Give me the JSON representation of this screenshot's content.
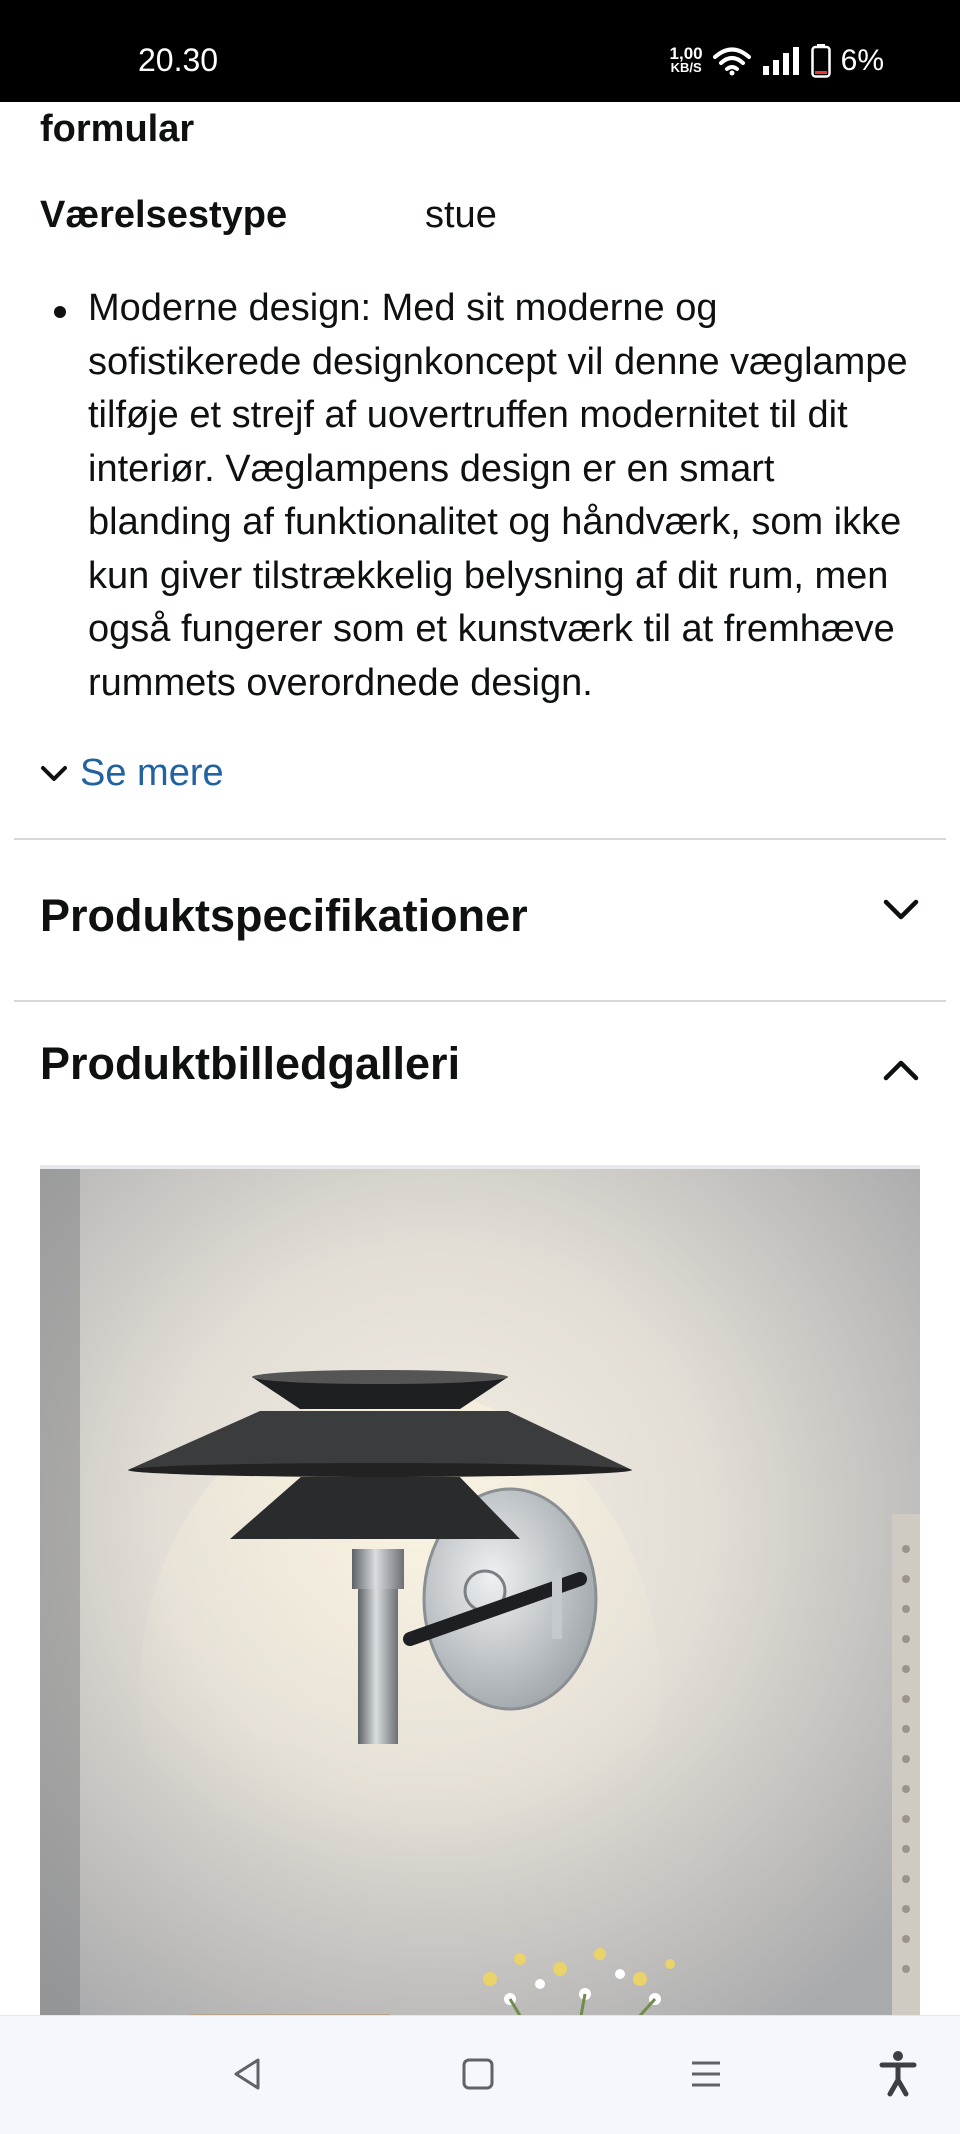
{
  "status_bar": {
    "time": "20.30",
    "net_speed_value": "1,00",
    "net_speed_unit": "KB/S",
    "battery": "6%"
  },
  "attributes": {
    "cut_label": "formular",
    "room_type_label": "Værelsestype",
    "room_type_value": "stue"
  },
  "description": {
    "bullets": [
      "Moderne design: Med sit moderne og sofistikerede designkoncept vil denne væglampe tilføje et strejf af uovertruffen modernitet til dit interiør. Væglampens design er en smart blanding af funktionalitet og håndværk, som ikke kun giver tilstrækkelig belysning af dit rum, men også fungerer som et kunstværk til at fremhæve rummets overordnede design."
    ],
    "see_more": "Se mere"
  },
  "sections": {
    "specs_title": "Produktspecifikationer",
    "gallery_title": "Produktbilledgalleri"
  },
  "colors": {
    "link": "#2162a1",
    "divider": "#d5d9d9",
    "text": "#0f1111"
  },
  "icons": {
    "see_more": "chevron-down-icon",
    "specs": "chevron-down-icon",
    "gallery": "chevron-up-icon",
    "nav_back": "back-triangle-icon",
    "nav_home": "home-square-icon",
    "nav_recents": "menu-lines-icon",
    "accessibility": "accessibility-icon"
  }
}
